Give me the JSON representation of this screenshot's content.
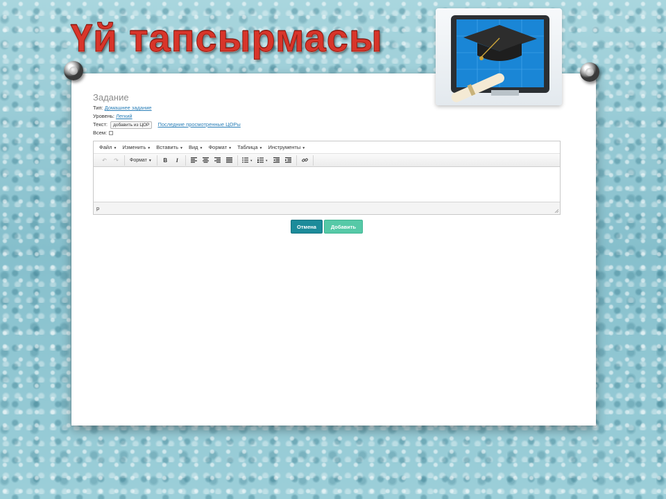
{
  "slide": {
    "title": "Үй тапсырмасы"
  },
  "logo": {
    "icon": "graduation-cap-monitor-icon"
  },
  "task": {
    "heading": "Задание",
    "type_label": "Тип:",
    "type_value": "Домашнее задание",
    "level_label": "Уровень:",
    "level_value": "Легкий",
    "text_label": "Текст:",
    "add_cor_label": "добавить из ЦОР",
    "recent_cor_link": "Последние просмотренные ЦОРы",
    "all_label": "Всем:"
  },
  "editor": {
    "menu": [
      "Файл",
      "Изменить",
      "Вставить",
      "Вид",
      "Формат",
      "Таблица",
      "Инструменты"
    ],
    "format_select": "Формат",
    "bold_label": "B",
    "italic_label": "I",
    "status_path": "p",
    "icons": [
      "undo-icon",
      "redo-icon",
      "bold-icon",
      "italic-icon",
      "align-left-icon",
      "align-center-icon",
      "align-right-icon",
      "align-justify-icon",
      "bullet-list-icon",
      "numbered-list-icon",
      "outdent-icon",
      "indent-icon",
      "link-icon"
    ]
  },
  "buttons": {
    "cancel": "Отмена",
    "add": "Добавить"
  },
  "colors": {
    "cancel": "#1c8b9a",
    "add": "#56c9a7",
    "title": "#d8352a",
    "link": "#2a7fb8"
  }
}
